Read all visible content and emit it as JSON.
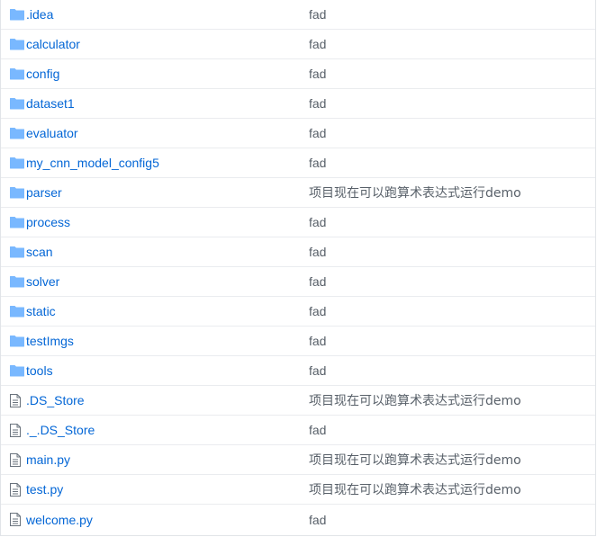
{
  "colors": {
    "folder_icon": "#79b8ff",
    "file_icon": "#6a737d",
    "link": "#0366d6",
    "message": "#586069",
    "border": "#e1e4e8"
  },
  "files": [
    {
      "type": "folder",
      "icon": "folder-icon",
      "name": ".idea",
      "message": "fad"
    },
    {
      "type": "folder",
      "icon": "folder-icon",
      "name": "calculator",
      "message": "fad"
    },
    {
      "type": "folder",
      "icon": "folder-icon",
      "name": "config",
      "message": "fad"
    },
    {
      "type": "folder",
      "icon": "folder-icon",
      "name": "dataset1",
      "message": "fad"
    },
    {
      "type": "folder",
      "icon": "folder-icon",
      "name": "evaluator",
      "message": "fad"
    },
    {
      "type": "folder",
      "icon": "folder-icon",
      "name": "my_cnn_model_config5",
      "message": "fad"
    },
    {
      "type": "folder",
      "icon": "folder-icon",
      "name": "parser",
      "message": "项目现在可以跑算术表达式运行demo"
    },
    {
      "type": "folder",
      "icon": "folder-icon",
      "name": "process",
      "message": "fad"
    },
    {
      "type": "folder",
      "icon": "folder-icon",
      "name": "scan",
      "message": "fad"
    },
    {
      "type": "folder",
      "icon": "folder-icon",
      "name": "solver",
      "message": "fad"
    },
    {
      "type": "folder",
      "icon": "folder-icon",
      "name": "static",
      "message": "fad"
    },
    {
      "type": "folder",
      "icon": "folder-icon",
      "name": "testImgs",
      "message": "fad"
    },
    {
      "type": "folder",
      "icon": "folder-icon",
      "name": "tools",
      "message": "fad"
    },
    {
      "type": "file",
      "icon": "file-icon",
      "name": ".DS_Store",
      "message": "项目现在可以跑算术表达式运行demo"
    },
    {
      "type": "file",
      "icon": "file-icon",
      "name": "._.DS_Store",
      "message": "fad"
    },
    {
      "type": "file",
      "icon": "file-icon",
      "name": "main.py",
      "message": "项目现在可以跑算术表达式运行demo"
    },
    {
      "type": "file",
      "icon": "file-icon",
      "name": "test.py",
      "message": "项目现在可以跑算术表达式运行demo"
    },
    {
      "type": "file",
      "icon": "file-icon",
      "name": "welcome.py",
      "message": "fad"
    }
  ]
}
